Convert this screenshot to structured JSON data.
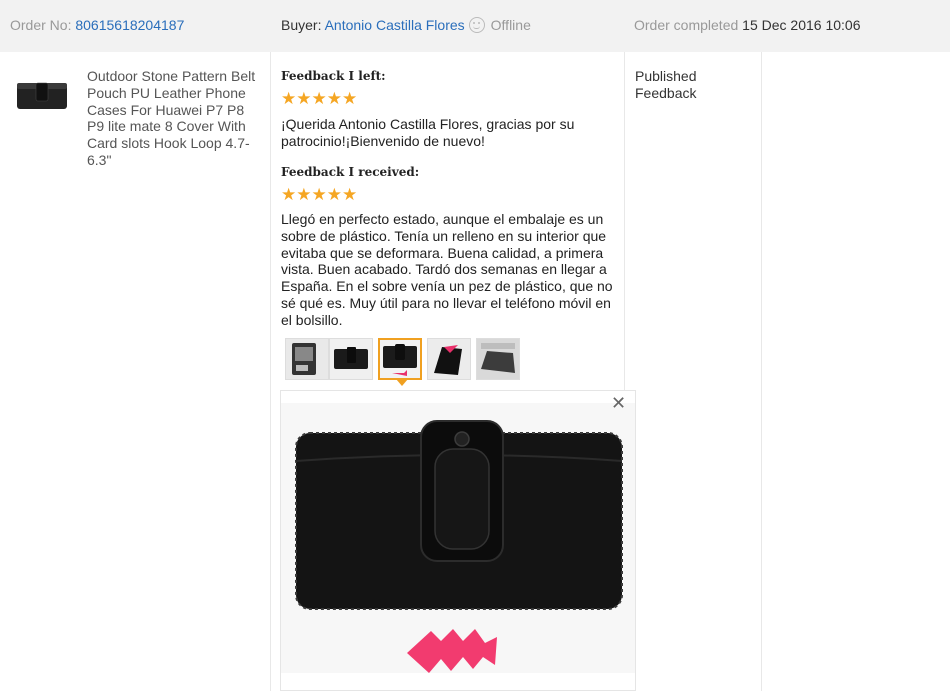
{
  "header": {
    "order_label": "Order No:",
    "order_number": "80615618204187",
    "buyer_label": "Buyer:",
    "buyer_name": "Antonio Castilla Flores",
    "buyer_status": "Offline",
    "completed_label": "Order completed",
    "completed_date": "15 Dec 2016 10:06"
  },
  "product": {
    "title": "Outdoor Stone Pattern Belt Pouch PU Leather Phone Cases For Huawei P7 P8 P9 lite mate 8 Cover With Card slots Hook Loop 4.7-6.3\""
  },
  "feedback_left": {
    "heading": "Feedback I left:",
    "stars": "★★★★★",
    "rating": 5,
    "text": "¡Querida Antonio Castilla Flores, gracias por su patrocinio!¡Bienvenido de nuevo!"
  },
  "feedback_received": {
    "heading": "Feedback I received:",
    "stars": "★★★★★",
    "rating": 5,
    "text": "Llegó en perfecto estado, aunque el embalaje es un sobre de plástico. Tenía un relleno en su interior que evitaba que se deformara. Buena calidad, a primera vista. Buen acabado. Tardó dos semanas en llegar a España. En el sobre venía un pez de plástico, que no sé qué es. Muy útil para no llevar el teléfono móvil en el bolsillo.",
    "photo_count": 5,
    "selected_photo": 3
  },
  "status": {
    "text": "Published Feedback"
  },
  "preview": {
    "close_icon": "close-icon"
  },
  "colors": {
    "link": "#2a6ebb",
    "star": "#f5a623",
    "accent": "#f0a020",
    "header_bg": "#f2f2f2"
  }
}
